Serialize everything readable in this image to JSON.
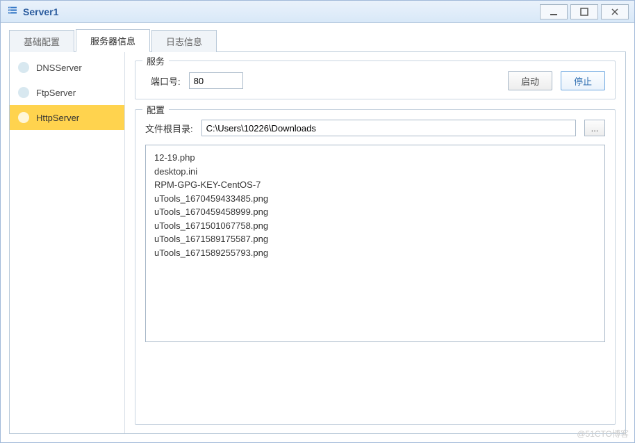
{
  "window": {
    "title": "Server1"
  },
  "tabs": [
    {
      "label": "基础配置",
      "active": false
    },
    {
      "label": "服务器信息",
      "active": true
    },
    {
      "label": "日志信息",
      "active": false
    }
  ],
  "sidebar": {
    "items": [
      {
        "label": "DNSServer",
        "active": false
      },
      {
        "label": "FtpServer",
        "active": false
      },
      {
        "label": "HttpServer",
        "active": true
      }
    ]
  },
  "service": {
    "group_title": "服务",
    "port_label": "端口号:",
    "port_value": "80",
    "start_label": "启动",
    "stop_label": "停止"
  },
  "config": {
    "group_title": "配置",
    "root_label": "文件根目录:",
    "root_value": "C:\\Users\\10226\\Downloads",
    "browse_label": "...",
    "files": [
      "12-19.php",
      "desktop.ini",
      "RPM-GPG-KEY-CentOS-7",
      "uTools_1670459433485.png",
      "uTools_1670459458999.png",
      "uTools_1671501067758.png",
      "uTools_1671589175587.png",
      "uTools_1671589255793.png"
    ]
  },
  "watermark": "@51CTO博客"
}
